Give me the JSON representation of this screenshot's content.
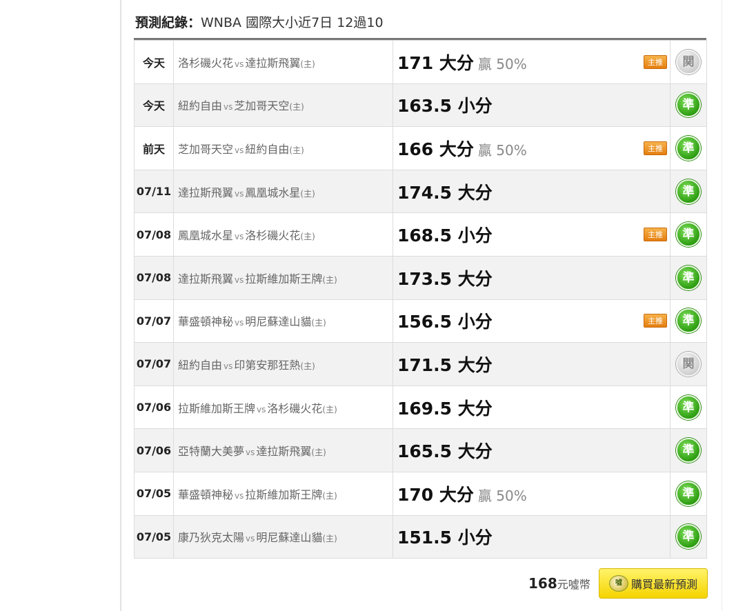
{
  "header": {
    "label": "預測紀錄：",
    "text": "WNBA 國際大小近7日 12過10"
  },
  "rows": [
    {
      "date": "今天",
      "away": "洛杉磯火花",
      "vs": "vs",
      "home": "達拉斯飛翼",
      "home_tag": "(主)",
      "pick": "171 大分",
      "win_rate": "贏 50%",
      "main_tag": "主推",
      "result": "関",
      "result_type": "push"
    },
    {
      "date": "今天",
      "away": "紐約自由",
      "vs": "vs",
      "home": "芝加哥天空",
      "home_tag": "(主)",
      "pick": "163.5 小分",
      "win_rate": "",
      "main_tag": "",
      "result": "準",
      "result_type": "hit"
    },
    {
      "date": "前天",
      "away": "芝加哥天空",
      "vs": "vs",
      "home": "紐約自由",
      "home_tag": "(主)",
      "pick": "166 大分",
      "win_rate": "贏 50%",
      "main_tag": "主推",
      "result": "準",
      "result_type": "hit"
    },
    {
      "date": "07/11",
      "away": "達拉斯飛翼",
      "vs": "vs",
      "home": "鳳凰城水星",
      "home_tag": "(主)",
      "pick": "174.5 大分",
      "win_rate": "",
      "main_tag": "",
      "result": "準",
      "result_type": "hit"
    },
    {
      "date": "07/08",
      "away": "鳳凰城水星",
      "vs": "vs",
      "home": "洛杉磯火花",
      "home_tag": "(主)",
      "pick": "168.5 小分",
      "win_rate": "",
      "main_tag": "主推",
      "result": "準",
      "result_type": "hit"
    },
    {
      "date": "07/08",
      "away": "達拉斯飛翼",
      "vs": "vs",
      "home": "拉斯維加斯王牌",
      "home_tag": "(主)",
      "pick": "173.5 大分",
      "win_rate": "",
      "main_tag": "",
      "result": "準",
      "result_type": "hit"
    },
    {
      "date": "07/07",
      "away": "華盛頓神秘",
      "vs": "vs",
      "home": "明尼蘇達山貓",
      "home_tag": "(主)",
      "pick": "156.5 小分",
      "win_rate": "",
      "main_tag": "主推",
      "result": "準",
      "result_type": "hit"
    },
    {
      "date": "07/07",
      "away": "紐約自由",
      "vs": "vs",
      "home": "印第安那狂熱",
      "home_tag": "(主)",
      "pick": "171.5 大分",
      "win_rate": "",
      "main_tag": "",
      "result": "関",
      "result_type": "push"
    },
    {
      "date": "07/06",
      "away": "拉斯維加斯王牌",
      "vs": "vs",
      "home": "洛杉磯火花",
      "home_tag": "(主)",
      "pick": "169.5 大分",
      "win_rate": "",
      "main_tag": "",
      "result": "準",
      "result_type": "hit"
    },
    {
      "date": "07/06",
      "away": "亞特蘭大美夢",
      "vs": "vs",
      "home": "達拉斯飛翼",
      "home_tag": "(主)",
      "pick": "165.5 大分",
      "win_rate": "",
      "main_tag": "",
      "result": "準",
      "result_type": "hit"
    },
    {
      "date": "07/05",
      "away": "華盛頓神秘",
      "vs": "vs",
      "home": "拉斯維加斯王牌",
      "home_tag": "(主)",
      "pick": "170 大分",
      "win_rate": "贏 50%",
      "main_tag": "",
      "result": "準",
      "result_type": "hit"
    },
    {
      "date": "07/05",
      "away": "康乃狄克太陽",
      "vs": "vs",
      "home": "明尼蘇達山貓",
      "home_tag": "(主)",
      "pick": "151.5 小分",
      "win_rate": "",
      "main_tag": "",
      "result": "準",
      "result_type": "hit"
    }
  ],
  "footer": {
    "price": "168",
    "unit": "元噓幣",
    "coin_icon": "coin-icon",
    "coin_text": "噓",
    "buy_label": "購買最新預測"
  }
}
